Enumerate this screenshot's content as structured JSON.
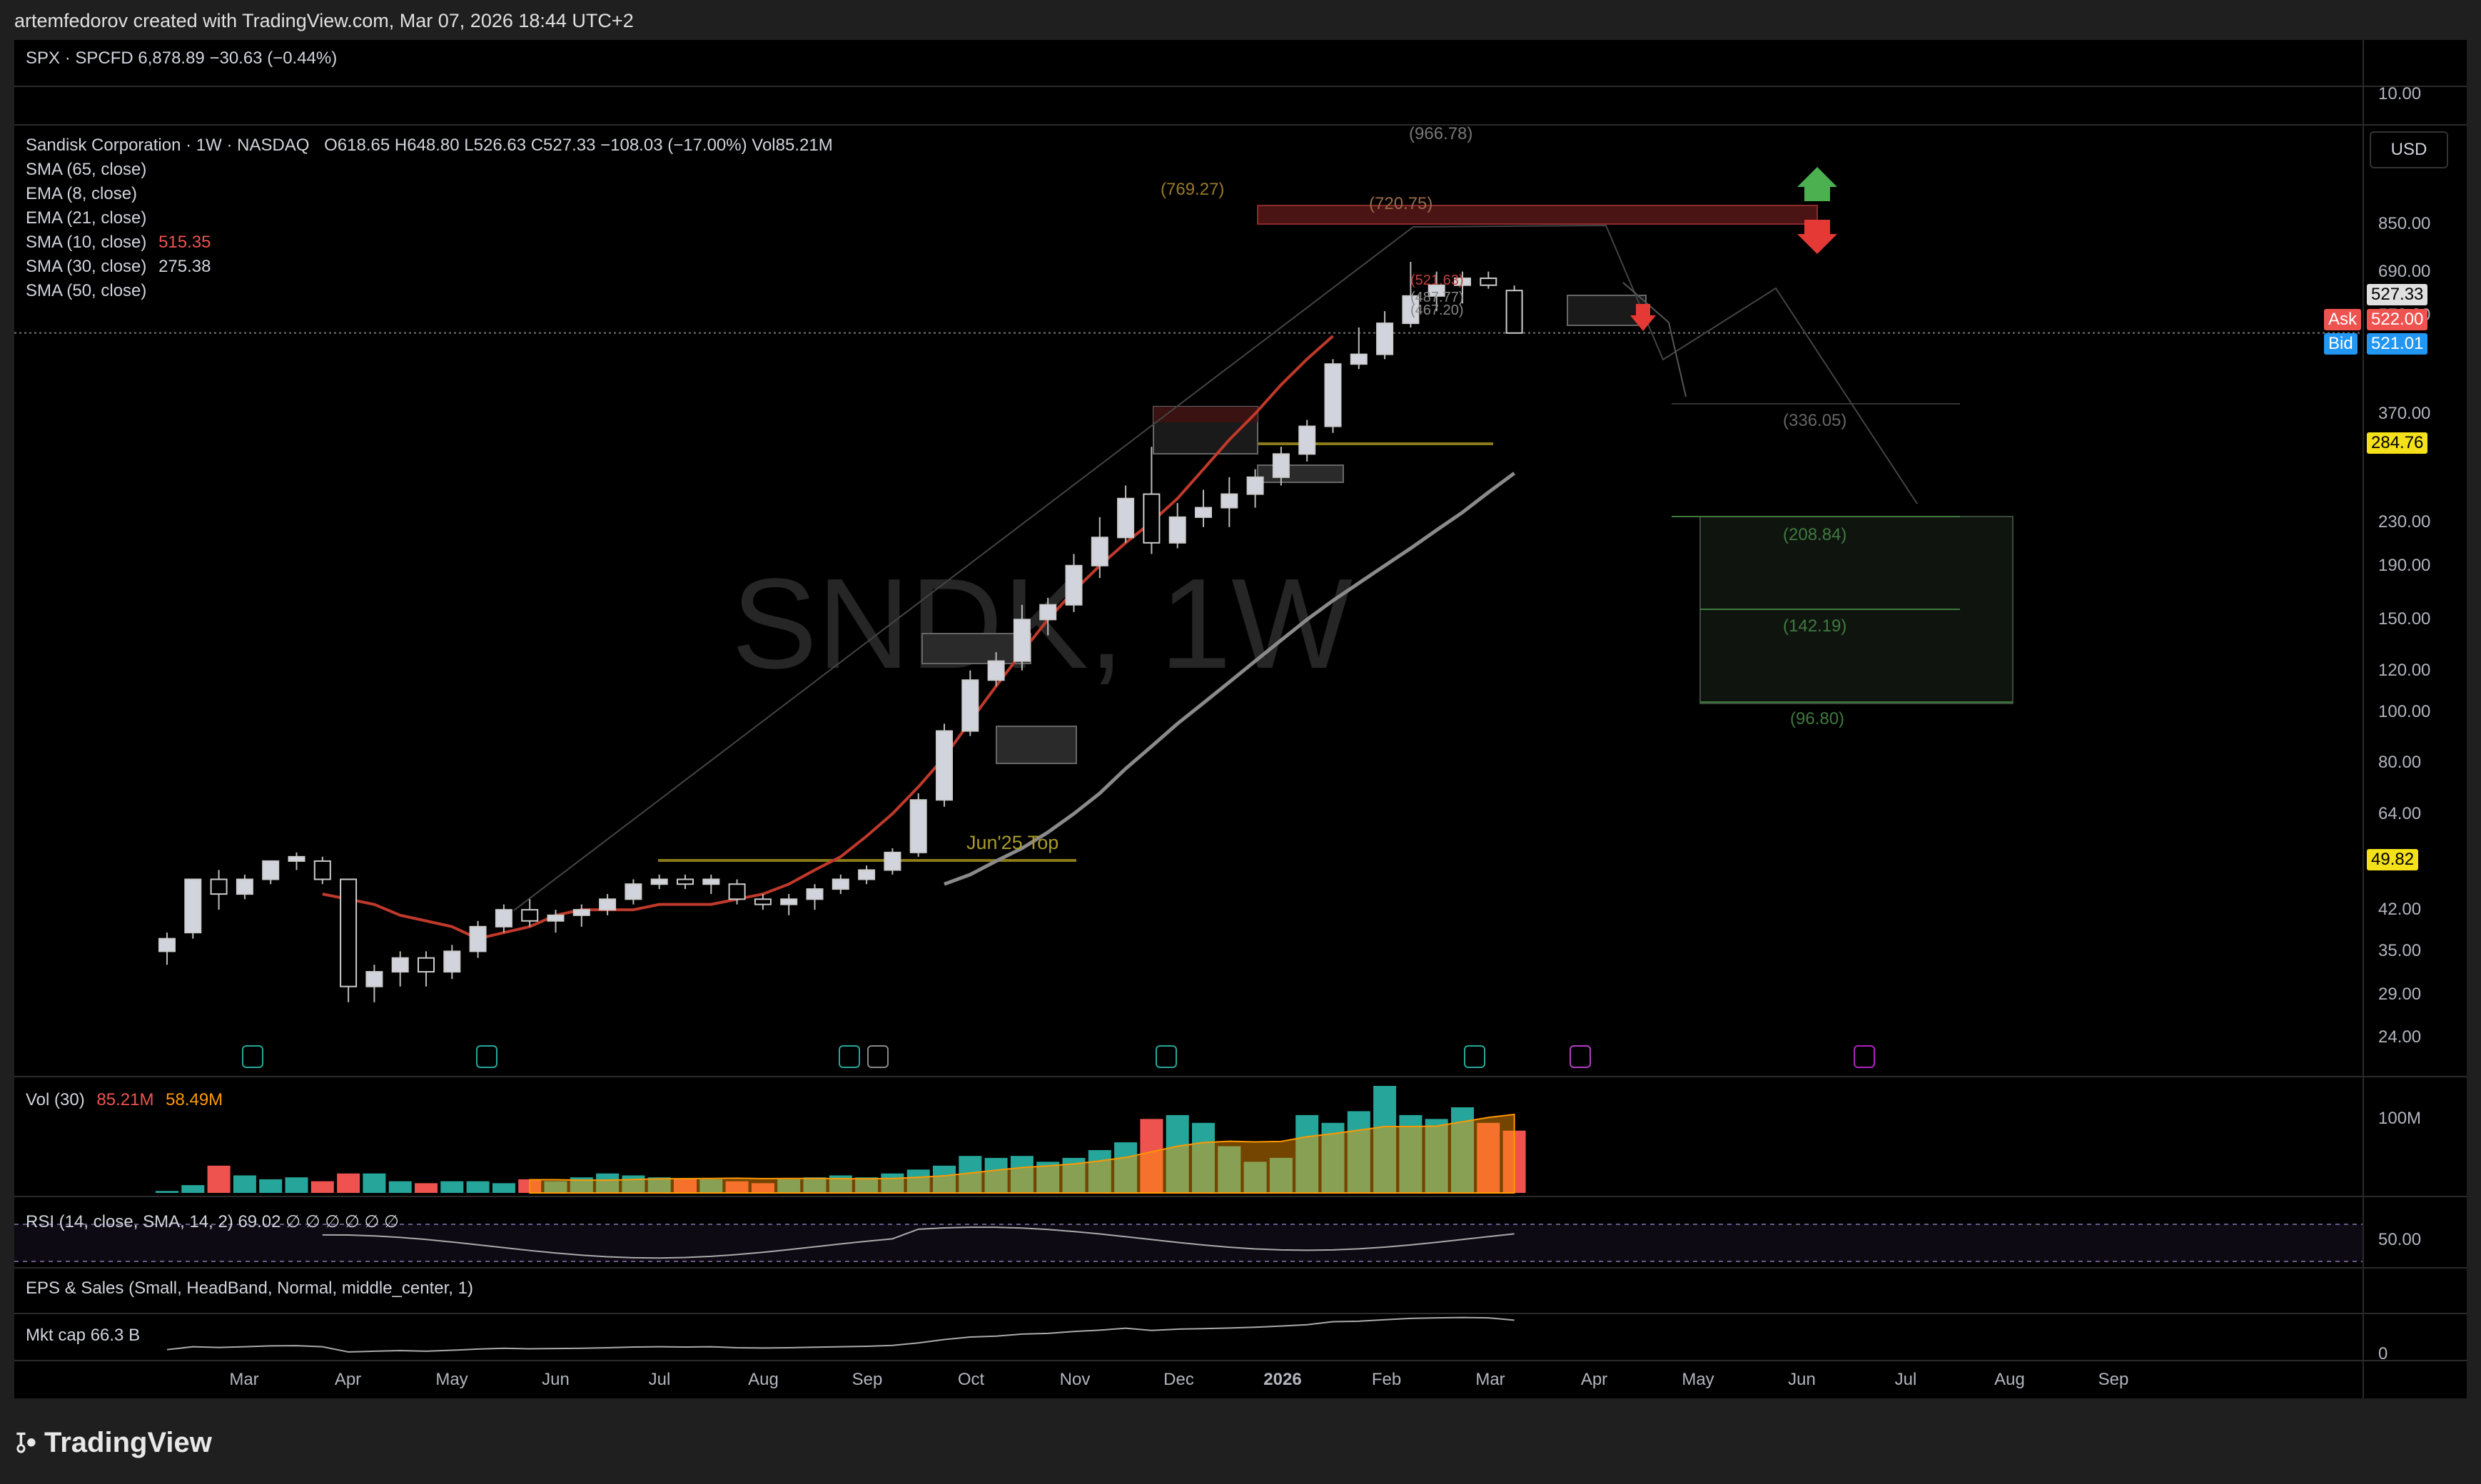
{
  "header": {
    "credit": "artemfedorov created with TradingView.com, Mar 07, 2026 18:44 UTC+2"
  },
  "spx": {
    "legend": "SPX · SPCFD  6,878.89  −30.63 (−0.44%)",
    "axis_label": "10.00"
  },
  "main": {
    "title": "Sandisk Corporation · 1W · NASDAQ",
    "ohlc": "O618.65  H648.80  L526.63  C527.33  −108.03 (−17.00%)  Vol85.21M",
    "indicators": [
      {
        "label": "SMA (65, close)",
        "value": ""
      },
      {
        "label": "EMA (8, close)",
        "value": ""
      },
      {
        "label": "EMA (21, close)",
        "value": ""
      },
      {
        "label": "SMA (10, close)",
        "value": "515.35"
      },
      {
        "label": "SMA (30, close)",
        "value": "275.38"
      },
      {
        "label": "SMA (50, close)",
        "value": ""
      }
    ],
    "watermark": "SNDK, 1W",
    "currency": "USD",
    "annotations": {
      "fib_top": "(966.78)",
      "a1": "(769.27)",
      "a2": "(720.75)",
      "a3": "(521.63)",
      "a4": "(487.77)",
      "a5": "(467.20)",
      "t1": "(336.05)",
      "t2": "(208.84)",
      "t3": "(142.19)",
      "t4": "(96.80)",
      "jun_top": "Jun'25 Top"
    },
    "badges": {
      "price": "527.33",
      "ask_label": "Ask",
      "ask": "522.00",
      "bid_label": "Bid",
      "bid": "521.01",
      "sma30": "284.76",
      "sma50": "49.82"
    }
  },
  "vol": {
    "legend": "Vol (30)",
    "v1": "85.21M",
    "v2": "58.49M",
    "axis": "100M"
  },
  "rsi": {
    "legend": "RSI (14, close, SMA, 14, 2)  69.02  ∅ ∅ ∅ ∅ ∅ ∅",
    "axis": "50.00"
  },
  "eps": {
    "legend": "EPS & Sales (Small, HeadBand, Normal, middle_center, 1)"
  },
  "mktcap": {
    "legend": "Mkt cap  66.3 B",
    "axis": "0"
  },
  "footer": {
    "brand": "TradingView"
  },
  "colors": {
    "up": "#d1d4dc",
    "down": "#000000",
    "ema21": "#c0392b",
    "sma30": "#8a8a8a",
    "vol_up": "#26a69a",
    "vol_down": "#ef5350"
  },
  "chart_data": {
    "type": "candlestick",
    "title": "Sandisk Corporation · 1W · NASDAQ",
    "y_scale": "log",
    "y_ticks": [
      850,
      690,
      570,
      370,
      230,
      190,
      150,
      120,
      100,
      80,
      64,
      42,
      35,
      29,
      24
    ],
    "x_ticks": [
      "Mar",
      "Apr",
      "May",
      "Jun",
      "Jul",
      "Aug",
      "Sep",
      "Oct",
      "Nov",
      "Dec",
      "2026",
      "Feb",
      "Mar",
      "Apr",
      "May",
      "Jun",
      "Jul",
      "Aug",
      "Sep"
    ],
    "candles": [
      [
        35,
        38,
        33,
        37
      ],
      [
        38,
        48,
        37,
        48
      ],
      [
        48,
        50,
        42,
        45
      ],
      [
        45,
        49,
        44,
        48
      ],
      [
        48,
        52,
        47,
        52
      ],
      [
        52,
        54,
        50,
        53
      ],
      [
        52,
        53,
        47,
        48
      ],
      [
        48,
        48,
        28,
        30
      ],
      [
        30,
        33,
        28,
        32
      ],
      [
        32,
        35,
        30,
        34
      ],
      [
        34,
        35,
        30,
        32
      ],
      [
        32,
        36,
        31,
        35
      ],
      [
        35,
        40,
        34,
        39
      ],
      [
        39,
        43,
        38,
        42
      ],
      [
        42,
        44,
        39,
        40
      ],
      [
        40,
        42,
        38,
        41
      ],
      [
        41,
        43,
        39,
        42
      ],
      [
        42,
        45,
        41,
        44
      ],
      [
        44,
        48,
        43,
        47
      ],
      [
        47,
        49,
        46,
        48
      ],
      [
        48,
        49,
        46,
        47
      ],
      [
        47,
        49,
        45,
        48
      ],
      [
        47,
        48,
        43,
        44
      ],
      [
        44,
        45,
        42,
        43
      ],
      [
        43,
        45,
        41,
        44
      ],
      [
        44,
        47,
        42,
        46
      ],
      [
        46,
        49,
        45,
        48
      ],
      [
        48,
        51,
        47,
        50
      ],
      [
        50,
        55,
        49,
        54
      ],
      [
        54,
        70,
        53,
        68
      ],
      [
        68,
        95,
        66,
        92
      ],
      [
        92,
        120,
        90,
        115
      ],
      [
        115,
        130,
        112,
        125
      ],
      [
        125,
        160,
        120,
        150
      ],
      [
        150,
        165,
        140,
        160
      ],
      [
        160,
        200,
        155,
        190
      ],
      [
        190,
        235,
        180,
        215
      ],
      [
        215,
        270,
        210,
        255
      ],
      [
        260,
        320,
        200,
        210
      ],
      [
        210,
        250,
        205,
        235
      ],
      [
        235,
        265,
        225,
        245
      ],
      [
        245,
        280,
        225,
        260
      ],
      [
        260,
        290,
        245,
        280
      ],
      [
        280,
        320,
        270,
        310
      ],
      [
        310,
        360,
        300,
        350
      ],
      [
        350,
        470,
        340,
        460
      ],
      [
        460,
        540,
        450,
        480
      ],
      [
        480,
        580,
        470,
        550
      ],
      [
        550,
        720,
        540,
        620
      ],
      [
        620,
        690,
        580,
        650
      ],
      [
        650,
        690,
        600,
        670
      ],
      [
        670,
        690,
        640,
        650
      ],
      [
        635,
        649,
        527,
        527
      ]
    ],
    "series": [
      {
        "name": "EMA (21, close)",
        "values": [
          45,
          44,
          43,
          41,
          40,
          39,
          37,
          38,
          39,
          41,
          42,
          42,
          42,
          43,
          43,
          43,
          44,
          45,
          47,
          50,
          53,
          58,
          64,
          72,
          82,
          96,
          112,
          130,
          150,
          170,
          190,
          210,
          230,
          255,
          290,
          330,
          370,
          420,
          470,
          520
        ]
      },
      {
        "name": "SMA (30, close)",
        "values": [
          47,
          49,
          52,
          55,
          59,
          64,
          70,
          78,
          86,
          95,
          104,
          114,
          125,
          137,
          150,
          163,
          176,
          190,
          205,
          222,
          240,
          262,
          285
        ]
      }
    ],
    "volume": [
      1,
      4,
      14,
      9,
      7,
      8,
      6,
      10,
      10,
      6,
      5,
      6,
      6,
      5,
      7,
      6,
      8,
      10,
      9,
      8,
      7,
      7,
      6,
      5,
      7,
      8,
      9,
      8,
      10,
      12,
      14,
      19,
      18,
      19,
      16,
      18,
      22,
      26,
      38,
      40,
      36,
      24,
      16,
      18,
      40,
      36,
      42,
      55,
      40,
      38,
      44,
      36,
      32
    ]
  }
}
